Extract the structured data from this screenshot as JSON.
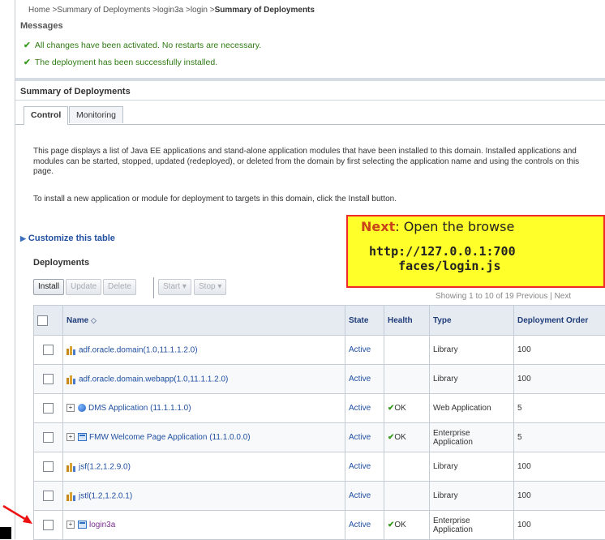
{
  "breadcrumb": {
    "path": "Home >Summary of Deployments >login3a >login >",
    "current": "Summary of Deployments"
  },
  "messages": {
    "title": "Messages",
    "items": [
      "All changes have been activated. No restarts are necessary.",
      "The deployment has been successfully installed."
    ]
  },
  "summary": {
    "title": "Summary of Deployments",
    "tabs": [
      "Control",
      "Monitoring"
    ],
    "description": "This page displays a list of Java EE applications and stand-alone application modules that have been installed to this domain. Installed applications and modules can be started, stopped, updated (redeployed), or deleted from the domain by first selecting the application name and using the controls on this page.",
    "install_note": "To install a new application or module for deployment to targets in this domain, click the Install button.",
    "customize_link": "Customize this table",
    "deployments_title": "Deployments"
  },
  "toolbar": {
    "install": "Install",
    "update": "Update",
    "delete": "Delete",
    "start": "Start",
    "stop": "Stop",
    "paging": "Showing 1 to 10 of 19   Previous | Next"
  },
  "table": {
    "headers": {
      "name": "Name",
      "state": "State",
      "health": "Health",
      "type": "Type",
      "order": "Deployment Order"
    },
    "rows": [
      {
        "name": "adf.oracle.domain(1.0,11.1.1.2.0)",
        "state": "Active",
        "health": "",
        "type": "Library",
        "order": "100",
        "icon": "library-icon",
        "expandable": false
      },
      {
        "name": "adf.oracle.domain.webapp(1.0,11.1.1.2.0)",
        "state": "Active",
        "health": "",
        "type": "Library",
        "order": "100",
        "icon": "library-icon",
        "expandable": false
      },
      {
        "name": "DMS Application (11.1.1.1.0)",
        "state": "Active",
        "health": "OK",
        "type": "Web Application",
        "order": "5",
        "icon": "web-app-icon",
        "expandable": true
      },
      {
        "name": "FMW Welcome Page Application (11.1.0.0.0)",
        "state": "Active",
        "health": "OK",
        "type": "Enterprise Application",
        "order": "5",
        "icon": "enterprise-app-icon",
        "expandable": true
      },
      {
        "name": "jsf(1.2,1.2.9.0)",
        "state": "Active",
        "health": "",
        "type": "Library",
        "order": "100",
        "icon": "library-icon",
        "expandable": false
      },
      {
        "name": "jstl(1.2,1.2.0.1)",
        "state": "Active",
        "health": "",
        "type": "Library",
        "order": "100",
        "icon": "library-icon",
        "expandable": false
      },
      {
        "name": "login3a",
        "state": "Active",
        "health": "OK",
        "type": "Enterprise Application",
        "order": "100",
        "icon": "enterprise-app-icon",
        "expandable": true
      }
    ]
  },
  "callout": {
    "lead": "Next",
    "text": ": Open the browse",
    "url": "http://127.0.0.1:700\n    faces/login.js"
  },
  "colors": {
    "accent": "#2150a0",
    "ok": "#3a9a20",
    "callout_bg": "#ffff2a",
    "callout_border": "#ee2a2a"
  }
}
